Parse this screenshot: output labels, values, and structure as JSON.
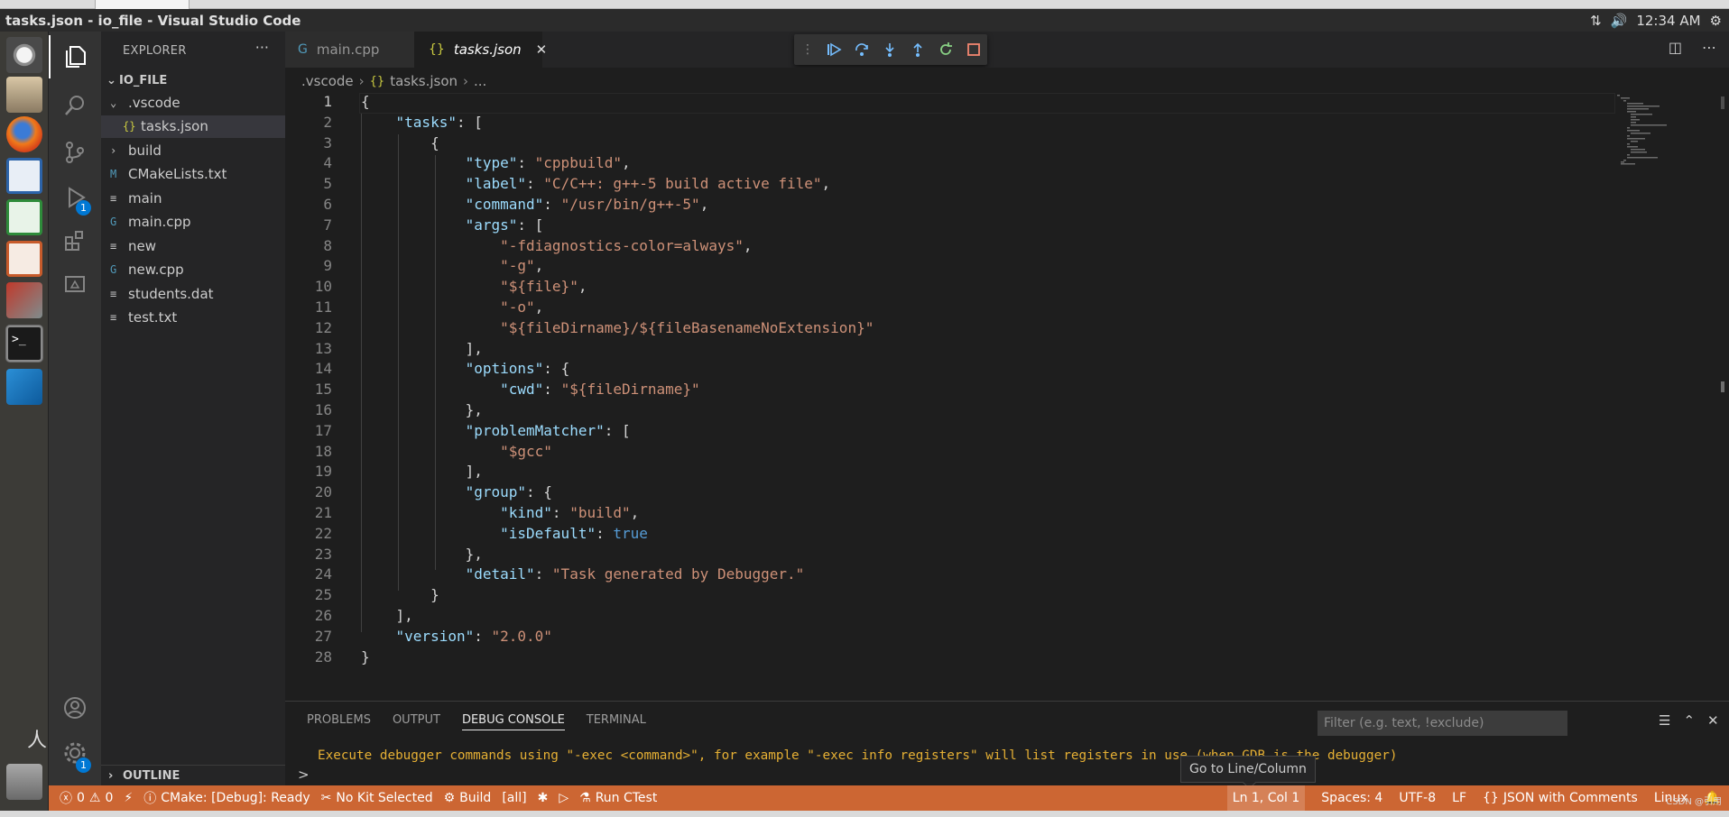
{
  "window": {
    "title": "tasks.json - io_file - Visual Studio Code"
  },
  "system": {
    "time": "12:34 AM"
  },
  "sidebar": {
    "title": "EXPLORER",
    "more": "···",
    "root": "IO_FILE",
    "items": [
      {
        "label": ".vscode",
        "type": "folder-open",
        "indent": 1
      },
      {
        "label": "tasks.json",
        "type": "json",
        "indent": 2,
        "selected": true
      },
      {
        "label": "build",
        "type": "folder",
        "indent": 1
      },
      {
        "label": "CMakeLists.txt",
        "type": "cmake",
        "indent": 1
      },
      {
        "label": "main",
        "type": "file",
        "indent": 1
      },
      {
        "label": "main.cpp",
        "type": "cpp",
        "indent": 1
      },
      {
        "label": "new",
        "type": "file",
        "indent": 1
      },
      {
        "label": "new.cpp",
        "type": "cpp",
        "indent": 1
      },
      {
        "label": "students.dat",
        "type": "file",
        "indent": 1
      },
      {
        "label": "test.txt",
        "type": "file",
        "indent": 1
      }
    ],
    "outline": "OUTLINE"
  },
  "activity": {
    "debug_badge": "1",
    "accounts_badge": "1"
  },
  "tabs": [
    {
      "label": "main.cpp",
      "icon": "cpp-icon",
      "active": false
    },
    {
      "label": "tasks.json",
      "icon": "json-icon",
      "active": true
    }
  ],
  "breadcrumb": {
    "folder": ".vscode",
    "file": "tasks.json",
    "more": "..."
  },
  "editor": {
    "lines": [
      [
        [
          "p",
          "{"
        ]
      ],
      [
        [
          "p",
          "    "
        ],
        [
          "k",
          "\"tasks\""
        ],
        [
          "p",
          ": ["
        ]
      ],
      [
        [
          "p",
          "        {"
        ]
      ],
      [
        [
          "p",
          "            "
        ],
        [
          "k",
          "\"type\""
        ],
        [
          "p",
          ": "
        ],
        [
          "s",
          "\"cppbuild\""
        ],
        [
          "p",
          ","
        ]
      ],
      [
        [
          "p",
          "            "
        ],
        [
          "k",
          "\"label\""
        ],
        [
          "p",
          ": "
        ],
        [
          "s",
          "\"C/C++: g++-5 build active file\""
        ],
        [
          "p",
          ","
        ]
      ],
      [
        [
          "p",
          "            "
        ],
        [
          "k",
          "\"command\""
        ],
        [
          "p",
          ": "
        ],
        [
          "s",
          "\"/usr/bin/g++-5\""
        ],
        [
          "p",
          ","
        ]
      ],
      [
        [
          "p",
          "            "
        ],
        [
          "k",
          "\"args\""
        ],
        [
          "p",
          ": ["
        ]
      ],
      [
        [
          "p",
          "                "
        ],
        [
          "s",
          "\"-fdiagnostics-color=always\""
        ],
        [
          "p",
          ","
        ]
      ],
      [
        [
          "p",
          "                "
        ],
        [
          "s",
          "\"-g\""
        ],
        [
          "p",
          ","
        ]
      ],
      [
        [
          "p",
          "                "
        ],
        [
          "s",
          "\"${file}\""
        ],
        [
          "p",
          ","
        ]
      ],
      [
        [
          "p",
          "                "
        ],
        [
          "s",
          "\"-o\""
        ],
        [
          "p",
          ","
        ]
      ],
      [
        [
          "p",
          "                "
        ],
        [
          "s",
          "\"${fileDirname}/${fileBasenameNoExtension}\""
        ]
      ],
      [
        [
          "p",
          "            ],"
        ]
      ],
      [
        [
          "p",
          "            "
        ],
        [
          "k",
          "\"options\""
        ],
        [
          "p",
          ": {"
        ]
      ],
      [
        [
          "p",
          "                "
        ],
        [
          "k",
          "\"cwd\""
        ],
        [
          "p",
          ": "
        ],
        [
          "s",
          "\"${fileDirname}\""
        ]
      ],
      [
        [
          "p",
          "            },"
        ]
      ],
      [
        [
          "p",
          "            "
        ],
        [
          "k",
          "\"problemMatcher\""
        ],
        [
          "p",
          ": ["
        ]
      ],
      [
        [
          "p",
          "                "
        ],
        [
          "s",
          "\"$gcc\""
        ]
      ],
      [
        [
          "p",
          "            ],"
        ]
      ],
      [
        [
          "p",
          "            "
        ],
        [
          "k",
          "\"group\""
        ],
        [
          "p",
          ": {"
        ]
      ],
      [
        [
          "p",
          "                "
        ],
        [
          "k",
          "\"kind\""
        ],
        [
          "p",
          ": "
        ],
        [
          "s",
          "\"build\""
        ],
        [
          "p",
          ","
        ]
      ],
      [
        [
          "p",
          "                "
        ],
        [
          "k",
          "\"isDefault\""
        ],
        [
          "p",
          ": "
        ],
        [
          "b",
          "true"
        ]
      ],
      [
        [
          "p",
          "            },"
        ]
      ],
      [
        [
          "p",
          "            "
        ],
        [
          "k",
          "\"detail\""
        ],
        [
          "p",
          ": "
        ],
        [
          "s",
          "\"Task generated by Debugger.\""
        ]
      ],
      [
        [
          "p",
          "        }"
        ]
      ],
      [
        [
          "p",
          "    ],"
        ]
      ],
      [
        [
          "p",
          "    "
        ],
        [
          "k",
          "\"version\""
        ],
        [
          "p",
          ": "
        ],
        [
          "s",
          "\"2.0.0\""
        ]
      ],
      [
        [
          "p",
          "}"
        ]
      ]
    ]
  },
  "panel": {
    "tabs": [
      "PROBLEMS",
      "OUTPUT",
      "DEBUG CONSOLE",
      "TERMINAL"
    ],
    "active_tab": "DEBUG CONSOLE",
    "filter_placeholder": "Filter (e.g. text, !exclude)",
    "message": "Execute debugger commands using \"-exec <command>\", for example \"-exec info registers\" will list registers in use (when GDB is the debugger)",
    "prompt": ">",
    "tooltip": "Go to Line/Column"
  },
  "status": {
    "errors": "0",
    "warnings": "0",
    "cmake": "CMake: [Debug]: Ready",
    "kit": "No Kit Selected",
    "build": "Build",
    "target": "[all]",
    "ctest": "Run CTest",
    "position": "Ln 1, Col 1",
    "spaces": "Spaces: 4",
    "encoding": "UTF-8",
    "eol": "LF",
    "language": "JSON with Comments",
    "os": "Linux"
  },
  "watermark": "CSDN @引用",
  "colors": {
    "statusbar": "#cc6633",
    "accent": "#0078d4",
    "key": "#9cdcfe",
    "string": "#ce9178",
    "keyword": "#569cd6"
  }
}
